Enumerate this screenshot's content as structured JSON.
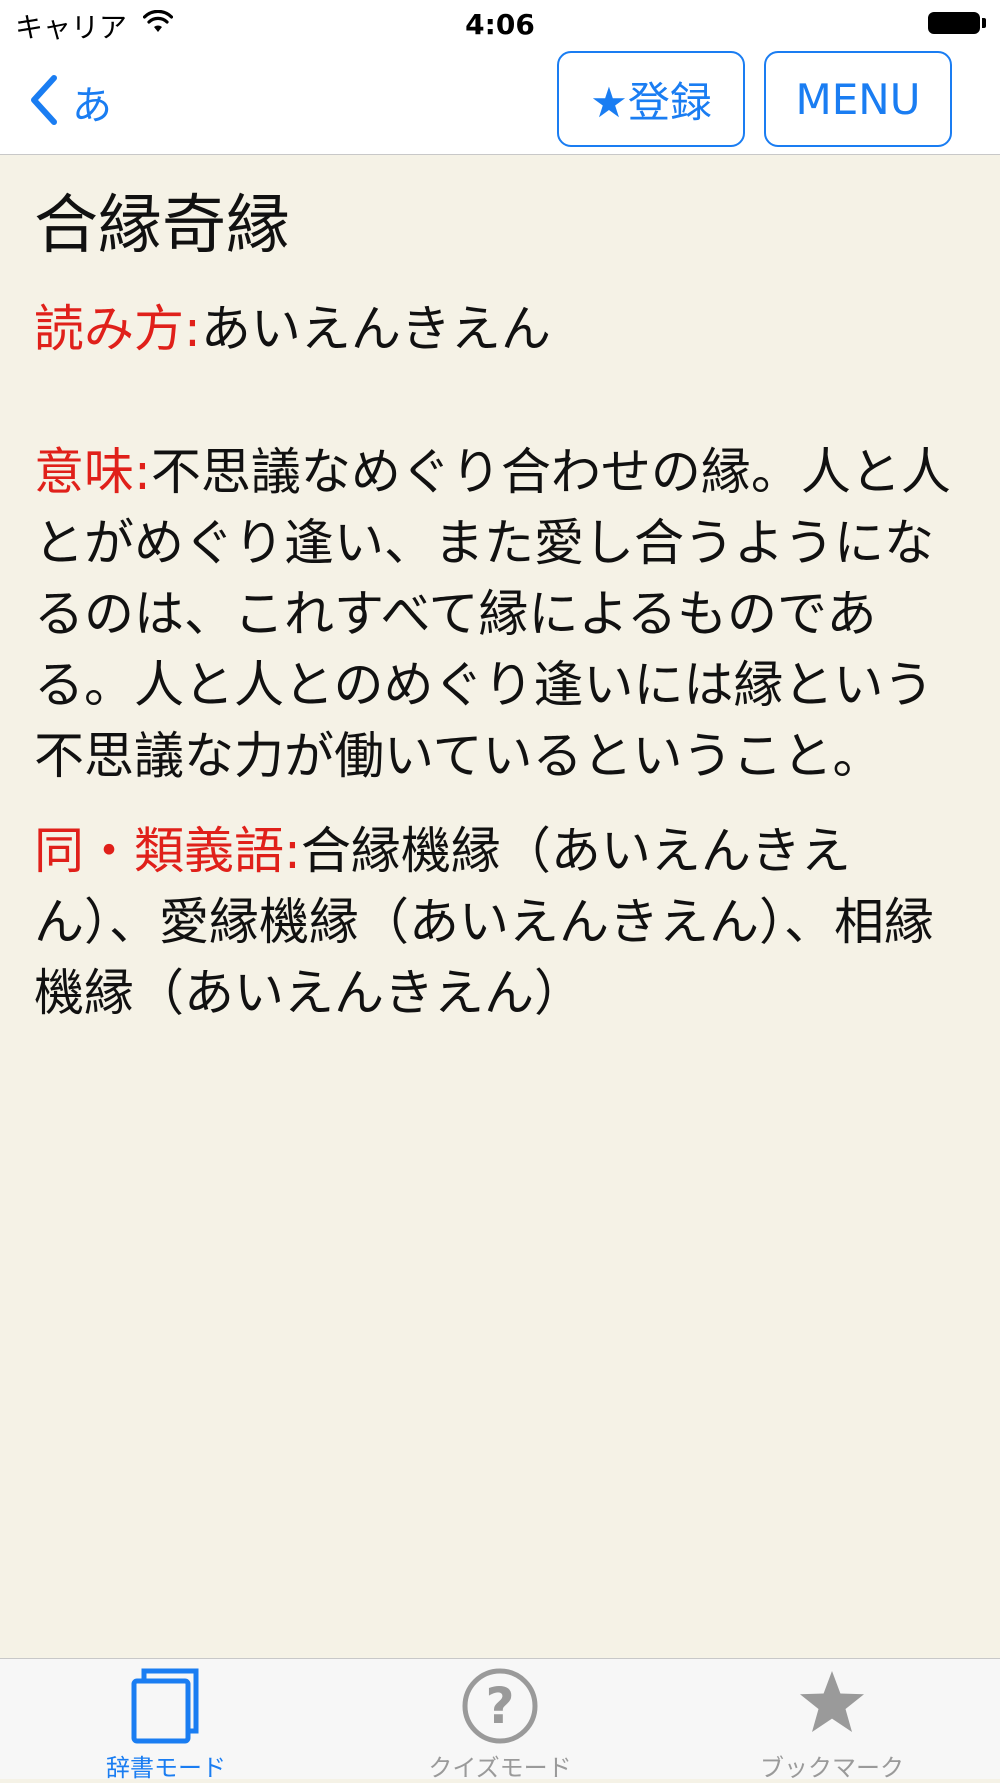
{
  "status_bar": {
    "carrier": "キャリア",
    "time": "4:06"
  },
  "nav": {
    "back_label": "あ",
    "register_label": "★登録",
    "menu_label": "MENU",
    "accent_color": "#1a7df2"
  },
  "entry": {
    "title": "合縁奇縁",
    "reading_label": "読み方:",
    "reading": "あいえんきえん",
    "meaning_label": "意味:",
    "meaning": "不思議なめぐり合わせの縁。人と人とがめぐり逢い、また愛し合うようになるのは、これすべて縁によるものである。人と人とのめぐり逢いには縁という不思議な力が働いているということ。",
    "synonym_label": "同・類義語:",
    "synonyms": "合縁機縁（あいえんきえん）、愛縁機縁（あいえんきえん）、相縁機縁（あいえんきえん）",
    "label_color": "#e0201a"
  },
  "tabs": [
    {
      "label": "辞書モード",
      "icon": "book-icon",
      "active": true,
      "color": "#1a7df2"
    },
    {
      "label": "クイズモード",
      "icon": "question-icon",
      "active": false,
      "color": "#9a9a9a"
    },
    {
      "label": "ブックマーク",
      "icon": "star-icon",
      "active": false,
      "color": "#9a9a9a"
    }
  ]
}
